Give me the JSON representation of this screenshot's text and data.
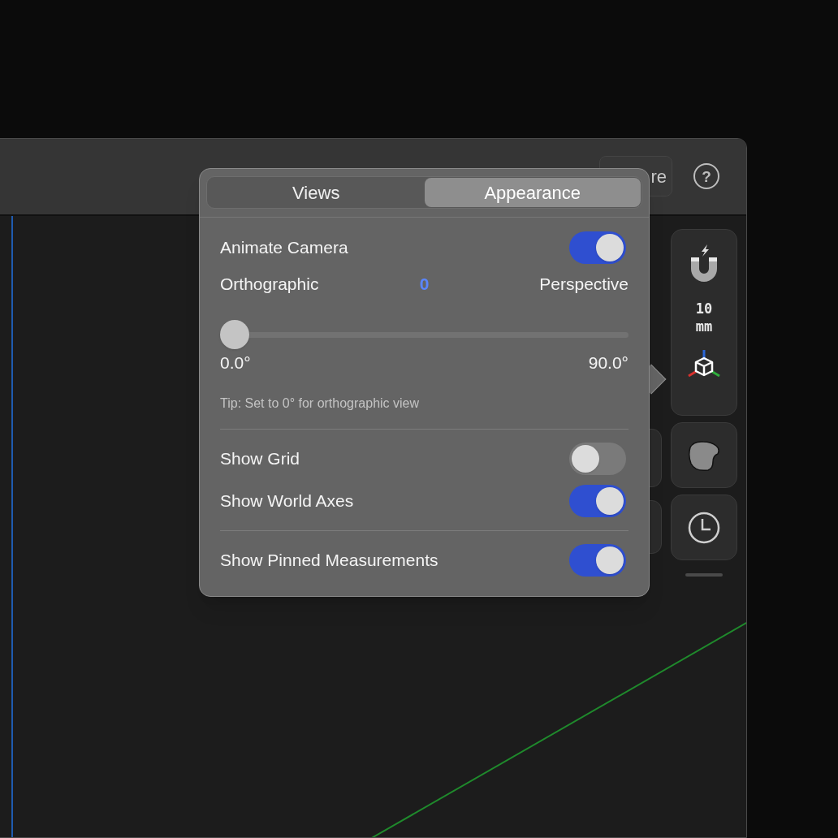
{
  "toolbar": {
    "partial_button": "re",
    "help_button": "?"
  },
  "side_panel": {
    "snap_value": "10",
    "snap_unit": "mm"
  },
  "popover": {
    "tabs": [
      {
        "label": "Views",
        "selected": false
      },
      {
        "label": "Appearance",
        "selected": true
      }
    ],
    "items": [
      {
        "kind": "toggle",
        "label": "Animate Camera",
        "on": true
      },
      {
        "kind": "range",
        "left_label": "Orthographic",
        "value": "0",
        "right_label": "Perspective",
        "level": 0,
        "min_label": "0.0°",
        "max_label": "90.0°"
      },
      {
        "kind": "tip",
        "text": "Tip: Set to 0° for orthographic view"
      },
      {
        "kind": "divider"
      },
      {
        "kind": "toggle",
        "label": "Show Grid",
        "on": false
      },
      {
        "kind": "toggle",
        "label": "Show World Axes",
        "on": true
      },
      {
        "kind": "divider"
      },
      {
        "kind": "toggle",
        "label": "Show Pinned Measurements",
        "on": true
      }
    ]
  }
}
